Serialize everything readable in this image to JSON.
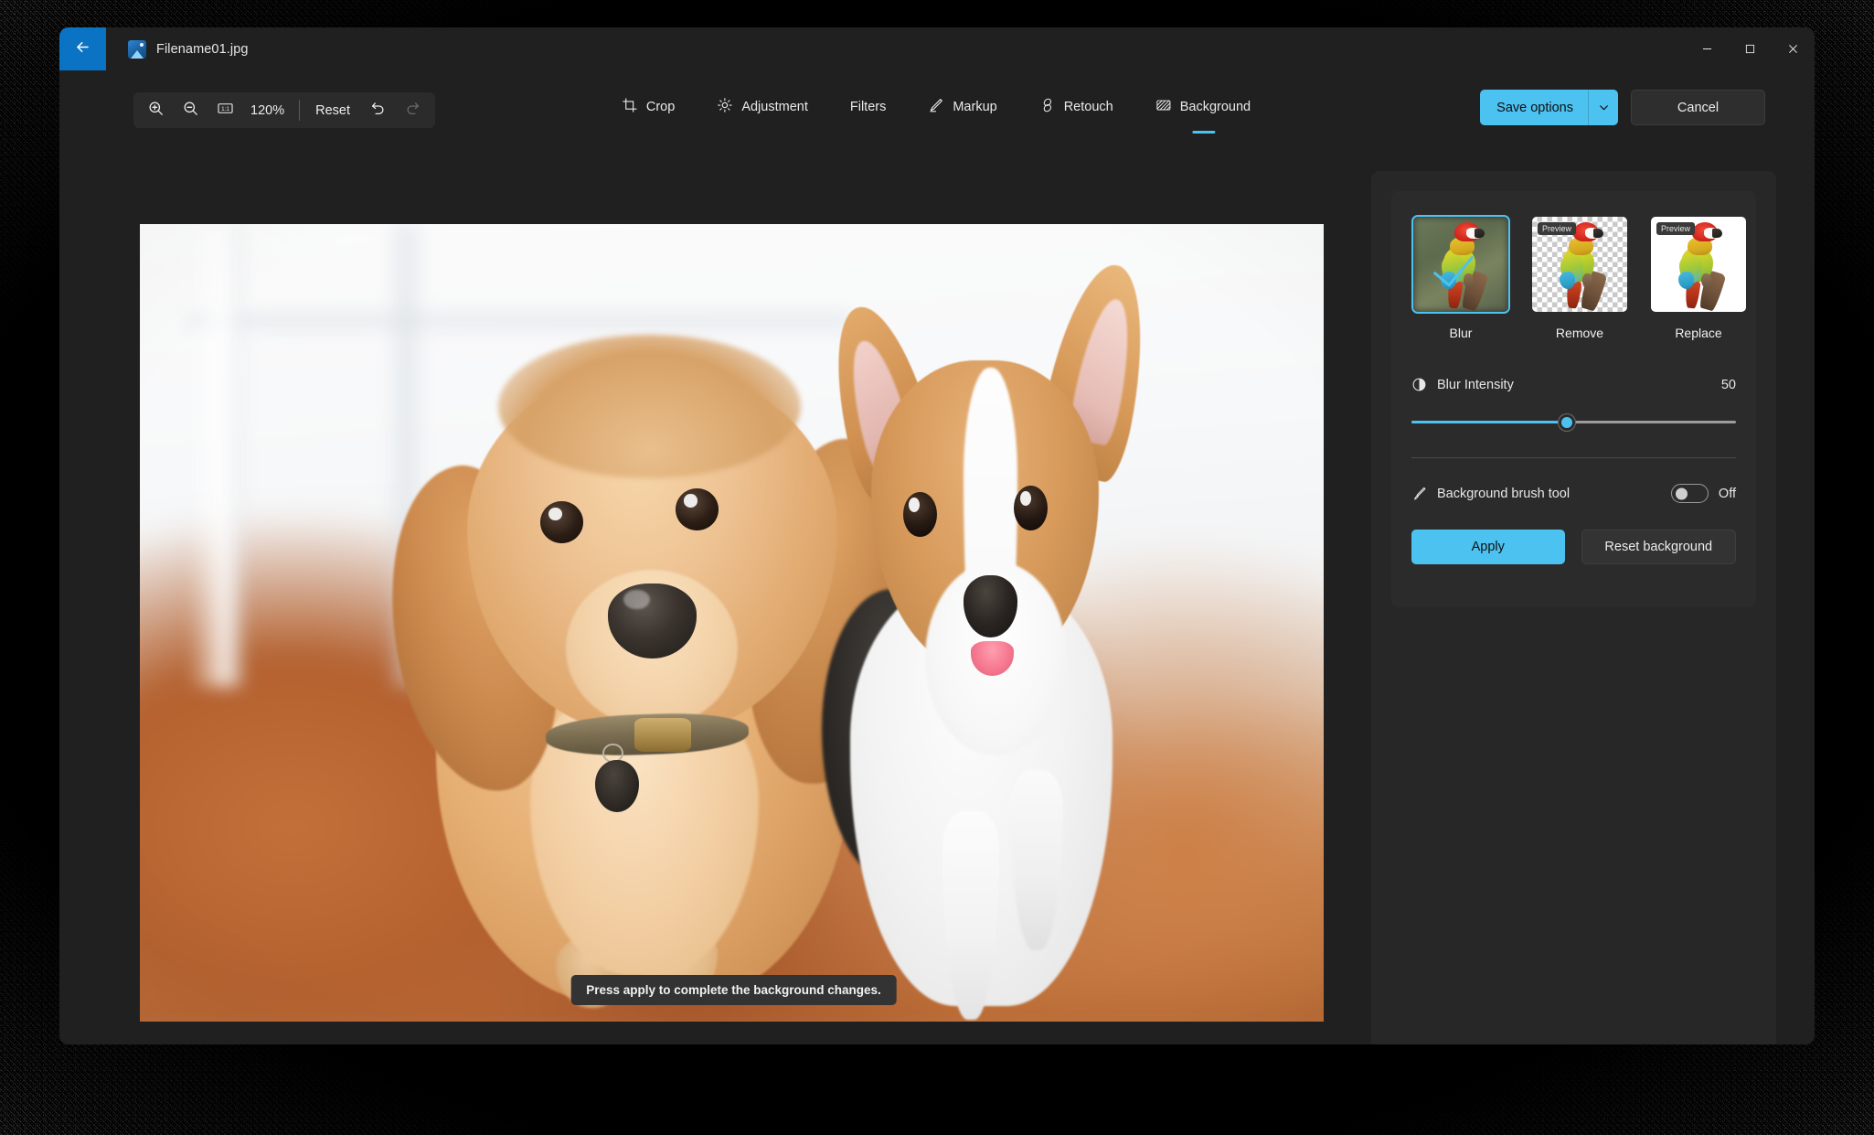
{
  "window": {
    "file_name": "Filename01.jpg",
    "back_icon": "back-arrow-icon",
    "file_icon": "image-file-icon",
    "minimize_label": "Minimize",
    "maximize_label": "Maximize",
    "close_label": "Close"
  },
  "toolbar": {
    "zoom_in_icon": "zoom-in-icon",
    "zoom_out_icon": "zoom-out-icon",
    "actual_size_icon": "actual-size-1-to-1-icon",
    "zoom_level": "120%",
    "reset_label": "Reset",
    "undo_icon": "undo-icon",
    "redo_icon": "redo-icon",
    "redo_disabled": true
  },
  "tabs": [
    {
      "label": "Crop",
      "icon": "crop-icon",
      "active": false
    },
    {
      "label": "Adjustment",
      "icon": "brightness-icon",
      "active": false
    },
    {
      "label": "Filters",
      "icon": "",
      "active": false
    },
    {
      "label": "Markup",
      "icon": "pen-icon",
      "active": false
    },
    {
      "label": "Retouch",
      "icon": "retouch-icon",
      "active": false
    },
    {
      "label": "Background",
      "icon": "background-icon",
      "active": true
    }
  ],
  "actions": {
    "save_options_label": "Save options",
    "save_options_chevron_icon": "chevron-down-icon",
    "cancel_label": "Cancel"
  },
  "canvas": {
    "toast_message": "Press apply to complete the background changes."
  },
  "panel": {
    "background_options": [
      {
        "label": "Blur",
        "style": "blur",
        "selected": true,
        "badge": ""
      },
      {
        "label": "Remove",
        "style": "checker",
        "selected": false,
        "badge": "Preview"
      },
      {
        "label": "Replace",
        "style": "white",
        "selected": false,
        "badge": "Preview"
      }
    ],
    "blur_intensity": {
      "icon": "contrast-icon",
      "label": "Blur Intensity",
      "value": "50",
      "percent": 48
    },
    "brush_tool": {
      "icon": "paint-brush-icon",
      "label": "Background brush tool",
      "state": "Off"
    },
    "apply_label": "Apply",
    "reset_background_label": "Reset background"
  },
  "colors": {
    "accent": "#4cc2f1",
    "back_button": "#0b73c4",
    "window_bg": "#202020",
    "panel_bg": "#272727",
    "card_bg": "#2b2b2b"
  }
}
